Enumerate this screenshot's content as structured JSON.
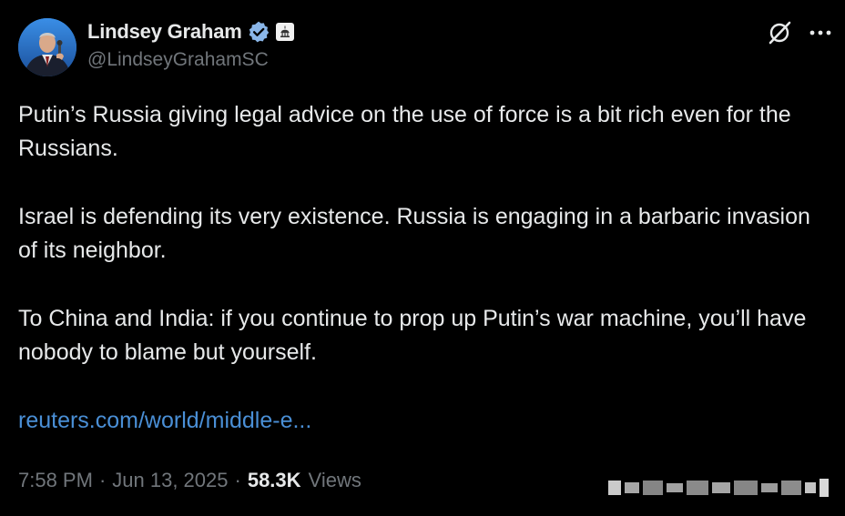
{
  "author": {
    "display_name": "Lindsey Graham",
    "handle": "@LindseyGrahamSC",
    "verified_icon": "verified-badge-icon",
    "affiliation_icon": "government-building-icon"
  },
  "toolbar": {
    "grok_icon": "grok-icon",
    "more_icon": "more-options-icon"
  },
  "tweet": {
    "paragraphs": [
      "Putin’s Russia giving legal advice on the use of force is a bit rich even for the Russians.",
      "Israel is defending its very existence. Russia is engaging in a barbaric invasion of its neighbor.",
      "To China and India: if you continue to prop up Putin’s war machine, you’ll have nobody to blame but yourself."
    ],
    "link_text": "reuters.com/world/middle-e..."
  },
  "meta": {
    "time": "7:58 PM",
    "separator": "·",
    "date": "Jun 13, 2025",
    "views_count": "58.3K",
    "views_label": "Views"
  },
  "colors": {
    "background": "#000000",
    "text_primary": "#e7e9ea",
    "text_secondary": "#71767b",
    "link": "#4a8fd6",
    "verified_blue": "#8ab6e8"
  }
}
